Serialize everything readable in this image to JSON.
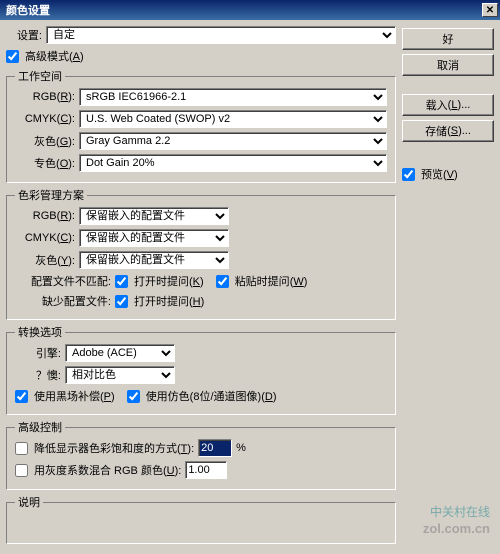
{
  "title": "颜色设置",
  "settings": {
    "label": "设置:",
    "value": "自定"
  },
  "advanced_mode": {
    "label": "高级模式",
    "key": "A"
  },
  "workspace": {
    "legend": "工作空间",
    "rgb": {
      "label": "RGB",
      "key": "R",
      "value": "sRGB IEC61966-2.1"
    },
    "cmyk": {
      "label": "CMYK",
      "key": "C",
      "value": "U.S. Web Coated (SWOP) v2"
    },
    "gray": {
      "label": "灰色",
      "key": "G",
      "value": "Gray Gamma 2.2"
    },
    "spot": {
      "label": "专色",
      "key": "O",
      "value": "Dot Gain 20%"
    }
  },
  "policies": {
    "legend": "色彩管理方案",
    "rgb": {
      "label": "RGB",
      "key": "R",
      "value": "保留嵌入的配置文件"
    },
    "cmyk": {
      "label": "CMYK",
      "key": "C",
      "value": "保留嵌入的配置文件"
    },
    "gray": {
      "label": "灰色",
      "key": "Y",
      "value": "保留嵌入的配置文件"
    },
    "mismatch": {
      "label": "配置文件不匹配:",
      "open": {
        "label": "打开时提问",
        "key": "K"
      },
      "paste": {
        "label": "粘贴时提问",
        "key": "W"
      }
    },
    "missing": {
      "label": "缺少配置文件:",
      "open": {
        "label": "打开时提问",
        "key": "H"
      }
    }
  },
  "conversion": {
    "legend": "转换选项",
    "engine": {
      "label": "引擎:",
      "value": "Adobe (ACE)"
    },
    "intent": {
      "label": "？懊:",
      "value": "相对比色"
    },
    "blackpoint": {
      "label": "使用黑场补偿",
      "key": "P"
    },
    "dither": {
      "label": "使用仿色(8位/通道图像)",
      "key": "D"
    }
  },
  "advanced_ctrl": {
    "legend": "高级控制",
    "desat": {
      "label": "降低显示器色彩饱和度的方式",
      "key": "T",
      "value": "20",
      "unit": "%"
    },
    "blend": {
      "label": "用灰度系数混合 RGB 颜色",
      "key": "U",
      "value": "1.00"
    }
  },
  "description": {
    "legend": "说明"
  },
  "buttons": {
    "ok": "好",
    "cancel": "取消",
    "load": "载入",
    "load_key": "L",
    "save": "存储",
    "save_key": "S"
  },
  "preview": {
    "label": "预览",
    "key": "V"
  },
  "watermark": {
    "cn": "中关村在线",
    "url": "zol.com.cn"
  }
}
